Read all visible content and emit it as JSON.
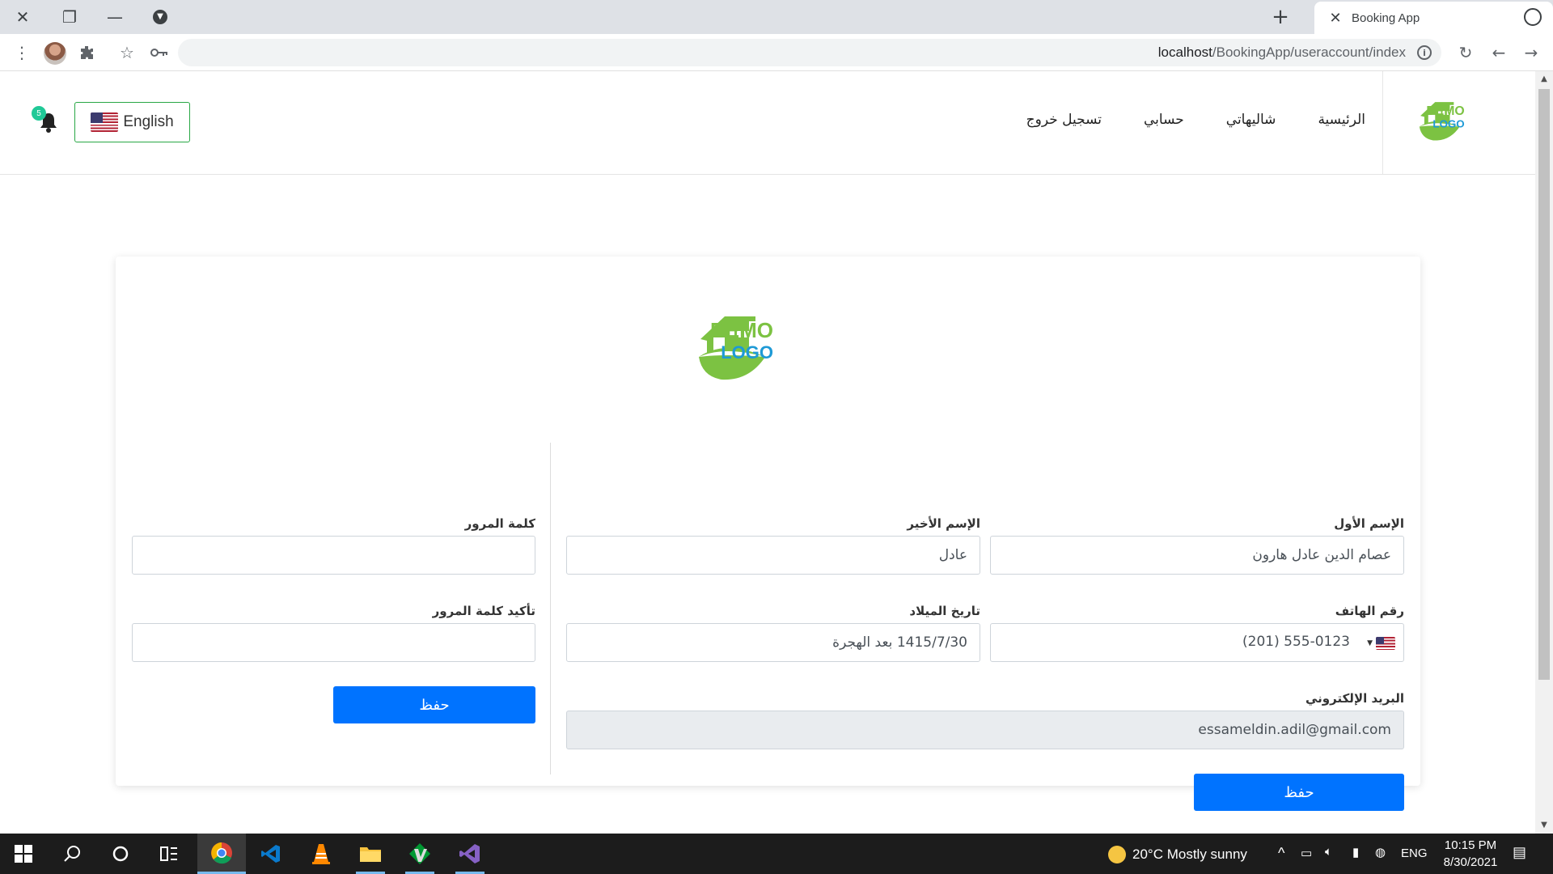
{
  "browser": {
    "tab_title": "Booking App",
    "url_host": "localhost",
    "url_path": "/BookingApp/useraccount/index"
  },
  "nav": {
    "links": [
      "الرئيسية",
      "شاليهاتي",
      "حسابي",
      "تسجيل خروج"
    ],
    "language_label": "English",
    "notification_count": "5"
  },
  "form": {
    "first_name": {
      "label": "الإسم الأول",
      "value": "عصام الدين عادل هارون"
    },
    "last_name": {
      "label": "الإسم الأخير",
      "value": "عادل"
    },
    "phone": {
      "label": "رقم الهاتف",
      "value": "(201) 555-0123"
    },
    "birth_date": {
      "label": "تاريخ الميلاد",
      "value": "1415/7/30 بعد الهجرة"
    },
    "email": {
      "label": "البريد الإلكتروني",
      "value": "essameldin.adil@gmail.com"
    },
    "save_label": "حفظ"
  },
  "password_form": {
    "password": {
      "label": "كلمة المرور",
      "value": ""
    },
    "confirm": {
      "label": "تأكيد كلمة المرور",
      "value": ""
    },
    "save_label": "حفظ"
  },
  "logo": {
    "line1": "DEMO",
    "line2": "LOGO"
  },
  "taskbar": {
    "weather": "20°C  Mostly sunny",
    "lang": "ENG",
    "time": "10:15 PM",
    "date": "8/30/2021"
  },
  "colors": {
    "primary": "#0073ff",
    "logo_green": "#7cc242",
    "logo_blue": "#1e9ad6",
    "badge": "#20c997"
  }
}
